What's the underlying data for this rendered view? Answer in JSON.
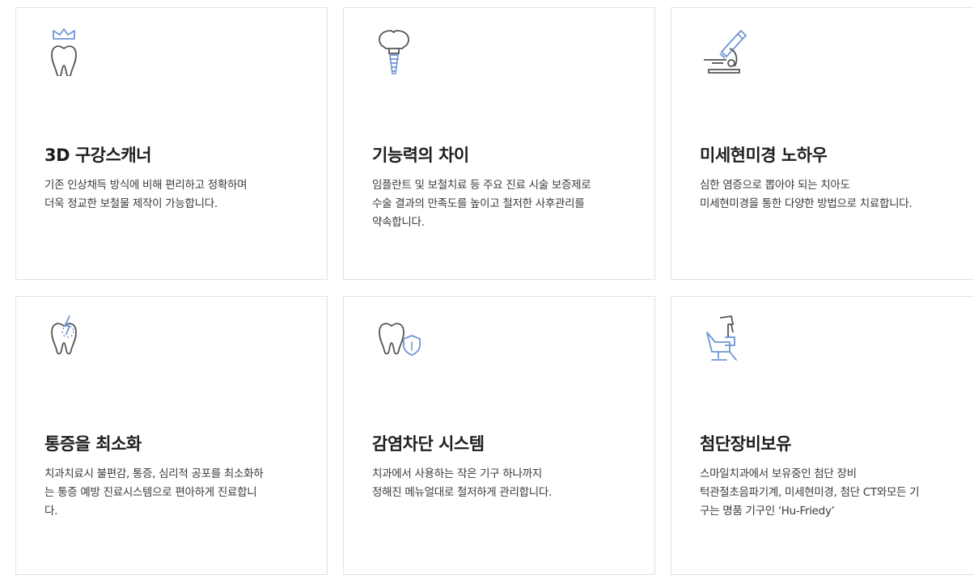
{
  "accent_color": "#6f95d6",
  "line_color": "#555555",
  "cards": [
    {
      "icon": "tooth-crown-icon",
      "title": "3D 구강스캐너",
      "lines": [
        "기존 인상채득 방식에 비해 편리하고 정확하며",
        "더욱 정교한 보철물 제작이 가능합니다."
      ]
    },
    {
      "icon": "dental-implant-icon",
      "title": "기능력의 차이",
      "lines": [
        "임플란트 및 보철치료 등 주요 진료 시술 보증제로",
        "수술 결과의 만족도를 높이고 철저한 사후관리를",
        "약속합니다."
      ]
    },
    {
      "icon": "microscope-icon",
      "title": "미세현미경 노하우",
      "lines": [
        "심한 염증으로 뽑아야 되는 치아도",
        "미세현미경을 통한 다양한 방법으로 치료합니다."
      ]
    },
    {
      "icon": "tooth-pain-icon",
      "title": "통증을 최소화",
      "lines": [
        "치과치료시 불편감, 통증, 심리적 공포를 최소화하",
        "는 통증 예방 진료시스템으로 편아하게 진료합니",
        "다."
      ]
    },
    {
      "icon": "tooth-shield-icon",
      "title": "감염차단 시스템",
      "lines": [
        "치과에서 사용하는 작은 기구 하나까지",
        "정해진 메뉴얼대로 철저하게 관리합니다."
      ]
    },
    {
      "icon": "dental-chair-icon",
      "title": "첨단장비보유",
      "lines": [
        "스마일치과에서 보유중인 첨단 장비",
        "턱관절초음파기계, 미세현미경, 첨단 CT와모든 기",
        "구는 명품 기구인 ‘Hu-Friedy’"
      ]
    }
  ]
}
